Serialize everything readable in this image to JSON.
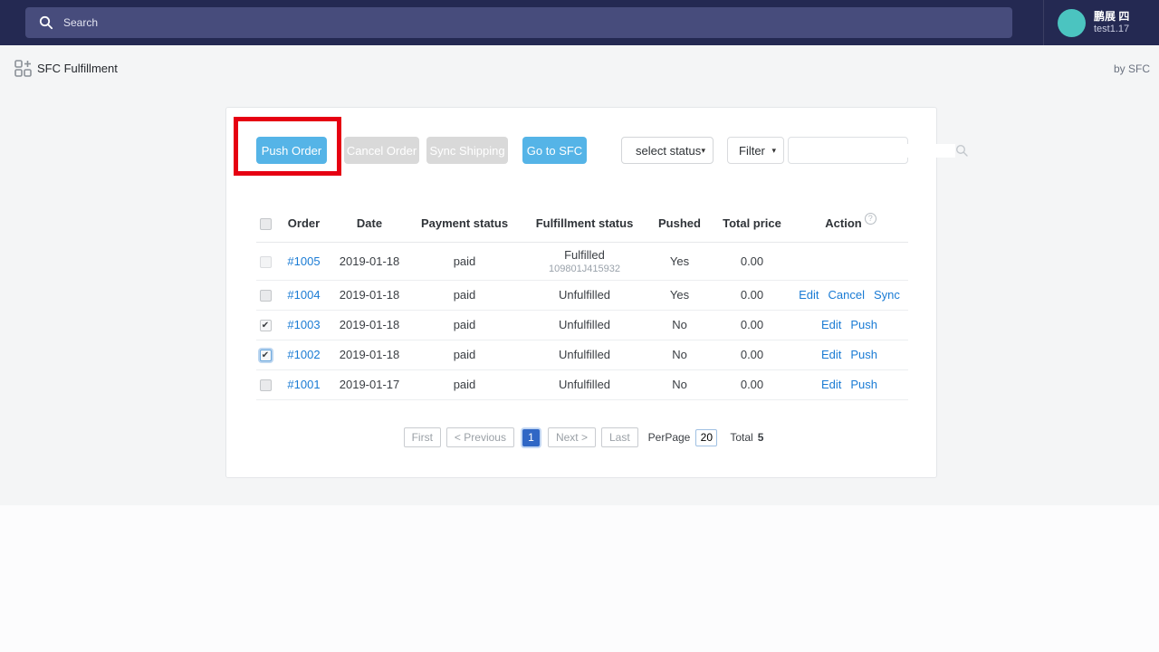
{
  "topbar": {
    "search_placeholder": "Search",
    "user_name": "鹏展 四",
    "shop_name": "test1.17"
  },
  "subheader": {
    "app_title": "SFC Fulfillment",
    "byline": "by SFC"
  },
  "toolbar": {
    "push_order_label": "Push Order",
    "cancel_order_label": "Cancel Order",
    "sync_shipping_label": "Sync Shipping",
    "go_to_sfc_label": "Go to SFC",
    "status_select_value": "select status",
    "filter_select_value": "Filter",
    "order_search_value": ""
  },
  "table": {
    "columns": [
      "Order",
      "Date",
      "Payment status",
      "Fulfillment status",
      "Pushed",
      "Total price",
      "Action"
    ],
    "rows": [
      {
        "order": "#1005",
        "date": "2019-01-18",
        "payment": "paid",
        "fulfillment": "Fulfilled",
        "fulfillment_sub": "109801J415932",
        "pushed": "Yes",
        "total": "0.00",
        "actions": [],
        "checked": false,
        "checkbox_disabled": true,
        "checkbox_focused": false
      },
      {
        "order": "#1004",
        "date": "2019-01-18",
        "payment": "paid",
        "fulfillment": "Unfulfilled",
        "fulfillment_sub": "",
        "pushed": "Yes",
        "total": "0.00",
        "actions": [
          "Edit",
          "Cancel",
          "Sync"
        ],
        "checked": false,
        "checkbox_disabled": false,
        "checkbox_focused": false
      },
      {
        "order": "#1003",
        "date": "2019-01-18",
        "payment": "paid",
        "fulfillment": "Unfulfilled",
        "fulfillment_sub": "",
        "pushed": "No",
        "total": "0.00",
        "actions": [
          "Edit",
          "Push"
        ],
        "checked": true,
        "checkbox_disabled": false,
        "checkbox_focused": false
      },
      {
        "order": "#1002",
        "date": "2019-01-18",
        "payment": "paid",
        "fulfillment": "Unfulfilled",
        "fulfillment_sub": "",
        "pushed": "No",
        "total": "0.00",
        "actions": [
          "Edit",
          "Push"
        ],
        "checked": true,
        "checkbox_disabled": false,
        "checkbox_focused": true
      },
      {
        "order": "#1001",
        "date": "2019-01-17",
        "payment": "paid",
        "fulfillment": "Unfulfilled",
        "fulfillment_sub": "",
        "pushed": "No",
        "total": "0.00",
        "actions": [
          "Edit",
          "Push"
        ],
        "checked": false,
        "checkbox_disabled": false,
        "checkbox_focused": false
      }
    ]
  },
  "pagination": {
    "first": "First",
    "previous": "< Previous",
    "current_page": "1",
    "next": "Next >",
    "last": "Last",
    "per_page_label": "PerPage",
    "per_page_value": "20",
    "total_label": "Total",
    "total_value": "5"
  },
  "icons": {
    "topbar_search": "magnifier",
    "order_search": "magnifier",
    "app": "apps-grid-plus",
    "action_help": "question-circle"
  },
  "colors": {
    "topbar_bg": "#242952",
    "topbar_search_bg": "#474c7c",
    "avatar": "#4bc4c0",
    "primary_button": "#55b4e7",
    "disabled_button": "#d9d9d9",
    "link": "#1a7bd4",
    "highlight_red": "#e60012",
    "active_page_bg": "#3067c5",
    "page_bg": "#f4f5f6"
  }
}
